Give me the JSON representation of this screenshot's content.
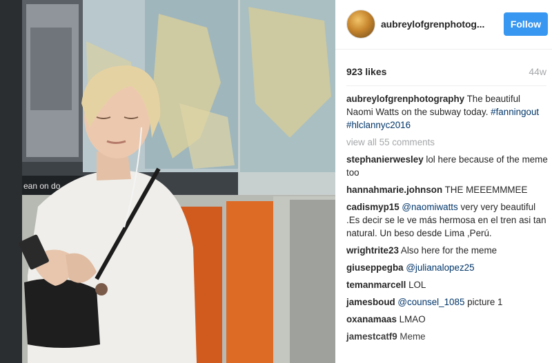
{
  "post": {
    "username": "aubreylofgrenphotog...",
    "follow_label": "Follow",
    "likes": "923 likes",
    "age": "44w",
    "caption": {
      "user": "aubreylofgrenphotography",
      "text": " The beautiful Naomi Watts on the subway today. ",
      "tag1": "#fanningout",
      "tag2": "#hlclannyc2016"
    },
    "view_all": "view all 55 comments"
  },
  "comments": [
    {
      "user": "stephanierwesley",
      "text": " lol here because of the meme too"
    },
    {
      "user": "hannahmarie.johnson",
      "text": " THE MEEEMMMEE"
    },
    {
      "user": "cadismyp15",
      "mention": " @naomiwatts",
      "text": " very very beautiful .Es decir se le ve más hermosa en el tren asi tan natural. Un beso desde Lima ,Perú."
    },
    {
      "user": "wrightrite23",
      "text": " Also here for the meme"
    },
    {
      "user": "giuseppegba",
      "mention": " @julianalopez25",
      "text": ""
    },
    {
      "user": "temanmarcell",
      "text": " LOL"
    },
    {
      "user": "jamesboud",
      "mention": " @counsel_1085",
      "text": " picture 1"
    },
    {
      "user": "oxanamaas",
      "text": " LMAO"
    },
    {
      "user": "jamestcatf9",
      "text": " Meme"
    }
  ],
  "photo": {
    "train_sign_text": "ean on do"
  },
  "colors": {
    "follow_bg": "#3897f0",
    "link": "#003569",
    "muted": "#a5a7aa"
  }
}
